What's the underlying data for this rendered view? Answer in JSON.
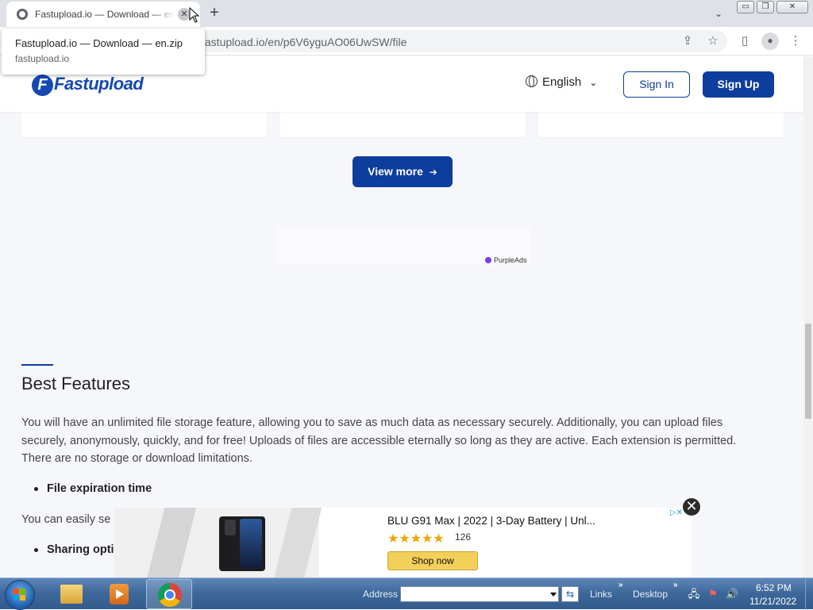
{
  "browser": {
    "tab": {
      "title": "Fastupload.io — Download — en.zip",
      "close_glyph": "✕"
    },
    "new_tab_glyph": "+",
    "tab_search_glyph": "⌄",
    "window_controls": {
      "minimize": "▭",
      "restore": "❐",
      "close": "✕"
    },
    "url": "fastupload.io/en/p6V6yguAO06UwSW/file",
    "hover_card": {
      "title": "Fastupload.io — Download — en.zip",
      "domain": "fastupload.io"
    },
    "toolbar_icons": {
      "share": "⇪",
      "bookmark": "☆",
      "sidepanel": "▯",
      "profile": "●",
      "menu": "⋮"
    }
  },
  "site": {
    "logo": {
      "mark": "F",
      "text": "Fastupload"
    },
    "language": {
      "label": "English",
      "chevron": "⌄"
    },
    "sign_in": "Sign In",
    "sign_up": "Sign Up",
    "view_more": "View more",
    "view_more_arrow": "➔",
    "ad_brand": "PurpleAds",
    "section_title": "Best Features",
    "intro": "You will have an unlimited file storage feature, allowing you to save as much data as necessary securely. Additionally, you can upload files securely, anonymously, quickly, and for free! Uploads of files are accessible eternally so long as they are active. Each extension is permitted. There are no storage or download limitations.",
    "bullets": [
      "File expiration time",
      "Sharing optic"
    ],
    "fragment": "You can easily se"
  },
  "banner_ad": {
    "title": "BLU G91 Max | 2022 | 3-Day Battery | Unl...",
    "stars": "★★★★★",
    "rating": 4.5,
    "review_count": "126",
    "cta": "Shop now",
    "adchoice": "▷✕",
    "close_glyph": "✕"
  },
  "taskbar": {
    "address_label": "Address",
    "address_value": "",
    "go_glyph": "⇆",
    "links_label": "Links",
    "desktop_label": "Desktop",
    "chevron": "»",
    "tray": {
      "network": "🖧",
      "flag": "⚑",
      "volume": "🔊"
    },
    "time": "6:52 PM",
    "date": "11/21/2022"
  },
  "colors": {
    "brand_blue": "#0d3e9e",
    "logo_blue": "#1448b3",
    "page_bg": "#f6f7fb",
    "purpleads": "#7a3cf0",
    "star": "#f0a500",
    "shop_button": "#f3cf5b"
  }
}
